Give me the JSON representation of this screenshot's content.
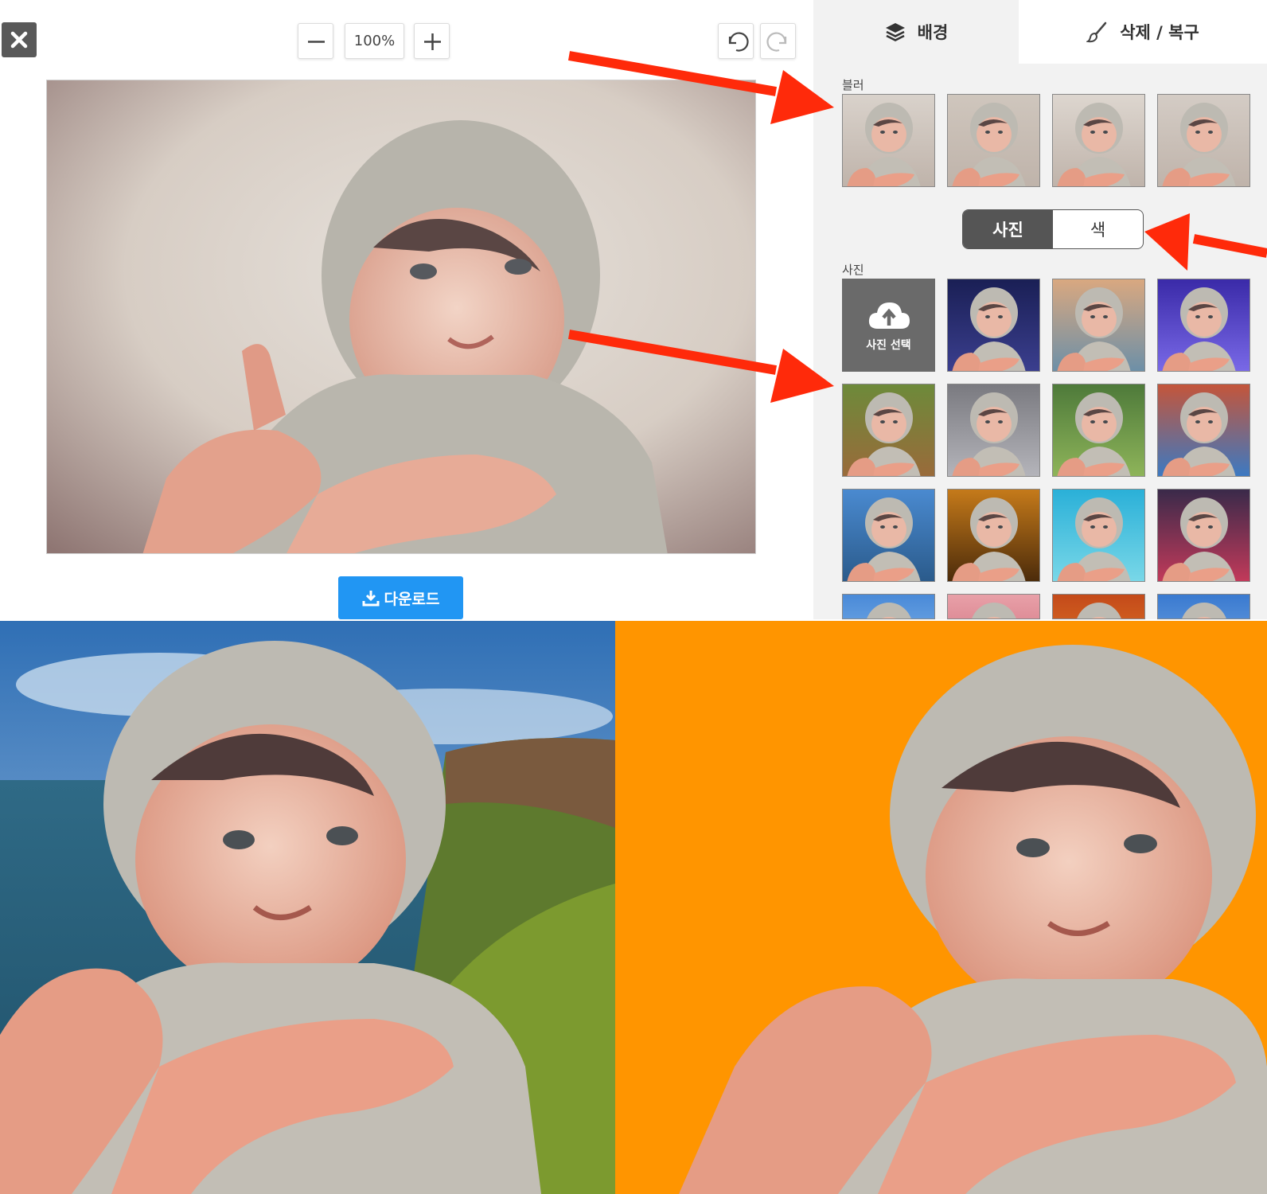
{
  "toolbar": {
    "close_icon": "close-icon",
    "zoom_out_icon": "minus-icon",
    "zoom_level": "100%",
    "zoom_in_icon": "plus-icon",
    "undo_icon": "undo-icon",
    "redo_icon": "redo-icon"
  },
  "editor": {
    "download_label": "다운로드",
    "download_icon": "download-icon",
    "download_color": "#2196f3"
  },
  "panel": {
    "tabs": [
      {
        "label": "배경",
        "icon": "layers-icon",
        "active": true
      },
      {
        "label": "삭제 / 복구",
        "icon": "brush-icon",
        "active": false
      }
    ],
    "blur_label": "블러",
    "blur_count": 4,
    "segmented": {
      "options": [
        "사진",
        "색"
      ],
      "selected": "사진"
    },
    "photo_label": "사진",
    "upload_label": "사진 선택",
    "upload_icon": "cloud-upload-icon",
    "photo_backgrounds": [
      "night-sky",
      "mountain-lake",
      "purple-arena",
      "wooden-village",
      "city-street",
      "village-grass",
      "street-art",
      "alpine-lake",
      "sunset-forest",
      "tropical-beach",
      "neon-city",
      "sky",
      "pink-bokeh",
      "autumn-leaves",
      "blue-sky"
    ]
  },
  "colors": {
    "panel_bg": "#f2f2f2",
    "segment_active": "#555555",
    "arrow": "#ff2a0a",
    "orange_bg": "#ff9500"
  },
  "arrows": {
    "icon": "arrow-icon",
    "count": 3
  }
}
